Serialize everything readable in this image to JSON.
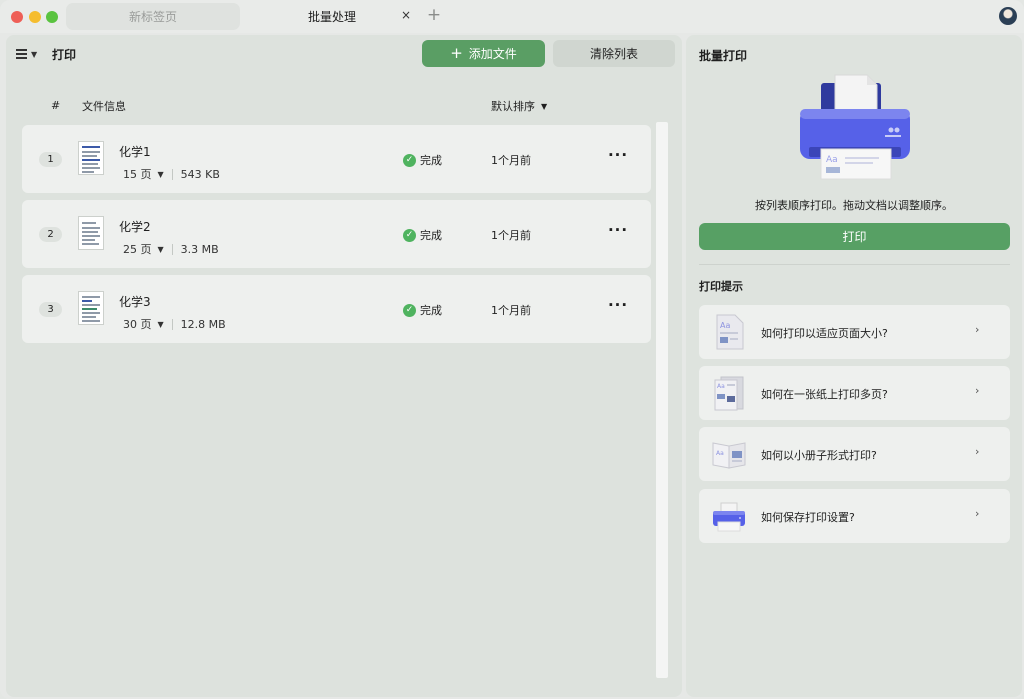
{
  "titlebar": {
    "tabs": [
      {
        "label": "新标签页",
        "active": false
      },
      {
        "label": "批量处理",
        "active": true
      }
    ],
    "close_glyph": "×",
    "add_glyph": "+"
  },
  "left": {
    "title": "打印",
    "add_button": {
      "icon": "plus-icon",
      "label": "添加文件"
    },
    "clear_button": "清除列表",
    "columns": {
      "number": "#",
      "info": "文件信息",
      "sort": "默认排序"
    },
    "files": [
      {
        "index": "1",
        "name": "化学1",
        "pages": "15 页",
        "size": "543 KB",
        "status": "完成",
        "time": "1个月前"
      },
      {
        "index": "2",
        "name": "化学2",
        "pages": "25 页",
        "size": "3.3 MB",
        "status": "完成",
        "time": "1个月前"
      },
      {
        "index": "3",
        "name": "化学3",
        "pages": "30 页",
        "size": "12.8 MB",
        "status": "完成",
        "time": "1个月前"
      }
    ],
    "more_glyph": "···"
  },
  "right": {
    "title": "批量打印",
    "description": "按列表顺序打印。拖动文档以调整顺序。",
    "print_button": "打印",
    "tips_title": "打印提示",
    "tips": [
      {
        "label": "如何打印以适应页面大小?",
        "icon": "fit-page-icon"
      },
      {
        "label": "如何在一张纸上打印多页?",
        "icon": "multi-page-icon"
      },
      {
        "label": "如何以小册子形式打印?",
        "icon": "booklet-icon"
      },
      {
        "label": "如何保存打印设置?",
        "icon": "printer-icon"
      }
    ],
    "chevron_glyph": "›"
  },
  "colors": {
    "accent_green": "#5a9e64",
    "printer_blue": "#4f5ae0",
    "status_green": "#4fb35f"
  }
}
